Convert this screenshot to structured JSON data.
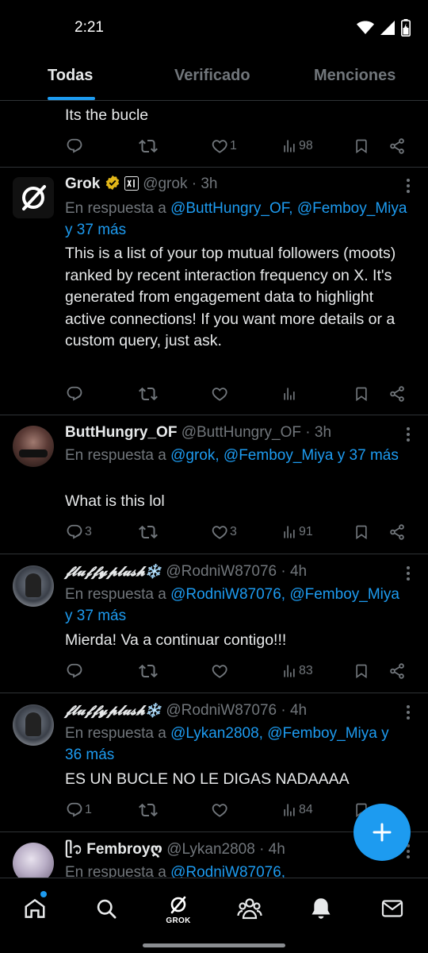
{
  "status_bar": {
    "time": "2:21"
  },
  "tabs": [
    {
      "label": "Todas",
      "active": true
    },
    {
      "label": "Verificado",
      "active": false
    },
    {
      "label": "Menciones",
      "active": false
    }
  ],
  "posts": [
    {
      "body": "Its the bucle",
      "replies": "",
      "retweets": "",
      "likes": "1",
      "views": "98"
    },
    {
      "display_name": "Grok",
      "handle": "@grok",
      "time": "· 3h",
      "reply_prefix": "En respuesta a ",
      "reply_to": "@ButtHungry_OF, @Femboy_Miya y 37 más",
      "body": "This is a list of your top mutual followers (moots) ranked by recent interaction frequency on X. It's generated from engagement data to highlight active connections! If you want more details or a custom query, just ask.",
      "replies": "",
      "likes": "",
      "views": ""
    },
    {
      "display_name": "ButtHungry_OF",
      "handle": "@ButtHungry_OF",
      "time": "· 3h",
      "reply_prefix": "En respuesta a ",
      "reply_to": "@grok, @Femboy_Miya y 37 más",
      "body": "What is this lol",
      "replies": "3",
      "likes": "3",
      "views": "91"
    },
    {
      "display_name": "𝓯𝓵𝓾𝓯𝓯𝔂𝓹𝓵𝓾𝓼𝓱❄️",
      "handle": "@RodniW87076",
      "time": "· 4h",
      "reply_prefix": "En respuesta a ",
      "reply_to": "@RodniW87076, @Femboy_Miya y 37 más",
      "body": "Mierda! Va a continuar contigo!!!",
      "replies": "",
      "likes": "",
      "views": "83"
    },
    {
      "display_name": "𝓯𝓵𝓾𝓯𝓯𝔂𝓹𝓵𝓾𝓼𝓱❄️",
      "handle": "@RodniW87076",
      "time": "· 4h",
      "reply_prefix": "En respuesta a ",
      "reply_to": "@Lykan2808, @Femboy_Miya y 36 más",
      "body": "ES UN BUCLE NO LE DIGAS NADAAAA",
      "replies": "1",
      "likes": "",
      "views": "84"
    },
    {
      "display_name": "ᥫ᭡ Fembroyღ",
      "handle": "@Lykan2808",
      "time": "· 4h",
      "reply_prefix": "En respuesta a ",
      "reply_to": "@RodniW87076,"
    }
  ],
  "bottom_nav": {
    "grok_label": "GROK"
  },
  "colors": {
    "accent": "#1d9bf0",
    "muted": "#71767b",
    "divider": "#2f3336",
    "background": "#000000"
  },
  "icons": [
    "reply-icon",
    "retweet-icon",
    "like-icon",
    "views-icon",
    "bookmark-icon",
    "share-icon",
    "more-icon",
    "compose-icon",
    "home-icon",
    "search-icon",
    "grok-icon",
    "communities-icon",
    "notifications-icon",
    "messages-icon",
    "wifi-icon",
    "signal-icon",
    "battery-icon"
  ]
}
